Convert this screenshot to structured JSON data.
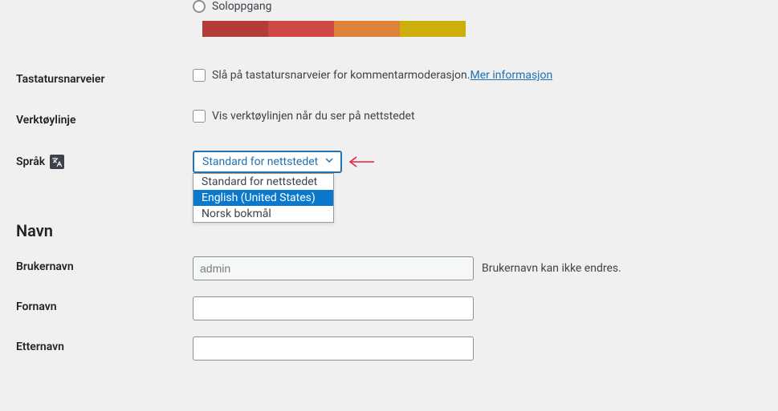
{
  "colorScheme": {
    "option_label": "Soloppgang",
    "colors": [
      "#b43c38",
      "#cf4944",
      "#dd823b",
      "#ccaf0b"
    ]
  },
  "keyboard_shortcuts": {
    "label": "Tastatursnarveier",
    "checkbox_label": "Slå på tastatursnarveier for kommentarmoderasjon. ",
    "link_text": "Mer informasjon"
  },
  "toolbar": {
    "label": "Verktøylinje",
    "checkbox_label": "Vis verktøylinjen når du ser på nettstedet"
  },
  "language": {
    "label": "Språk",
    "selected": "Standard for nettstedet",
    "options": [
      "Standard for nettstedet",
      "English (United States)",
      "Norsk bokmål"
    ],
    "highlighted_index": 1
  },
  "section_name": "Navn",
  "username": {
    "label": "Brukernavn",
    "value": "admin",
    "hint": "Brukernavn kan ikke endres."
  },
  "firstname": {
    "label": "Fornavn",
    "value": ""
  },
  "lastname": {
    "label": "Etternavn",
    "value": ""
  }
}
